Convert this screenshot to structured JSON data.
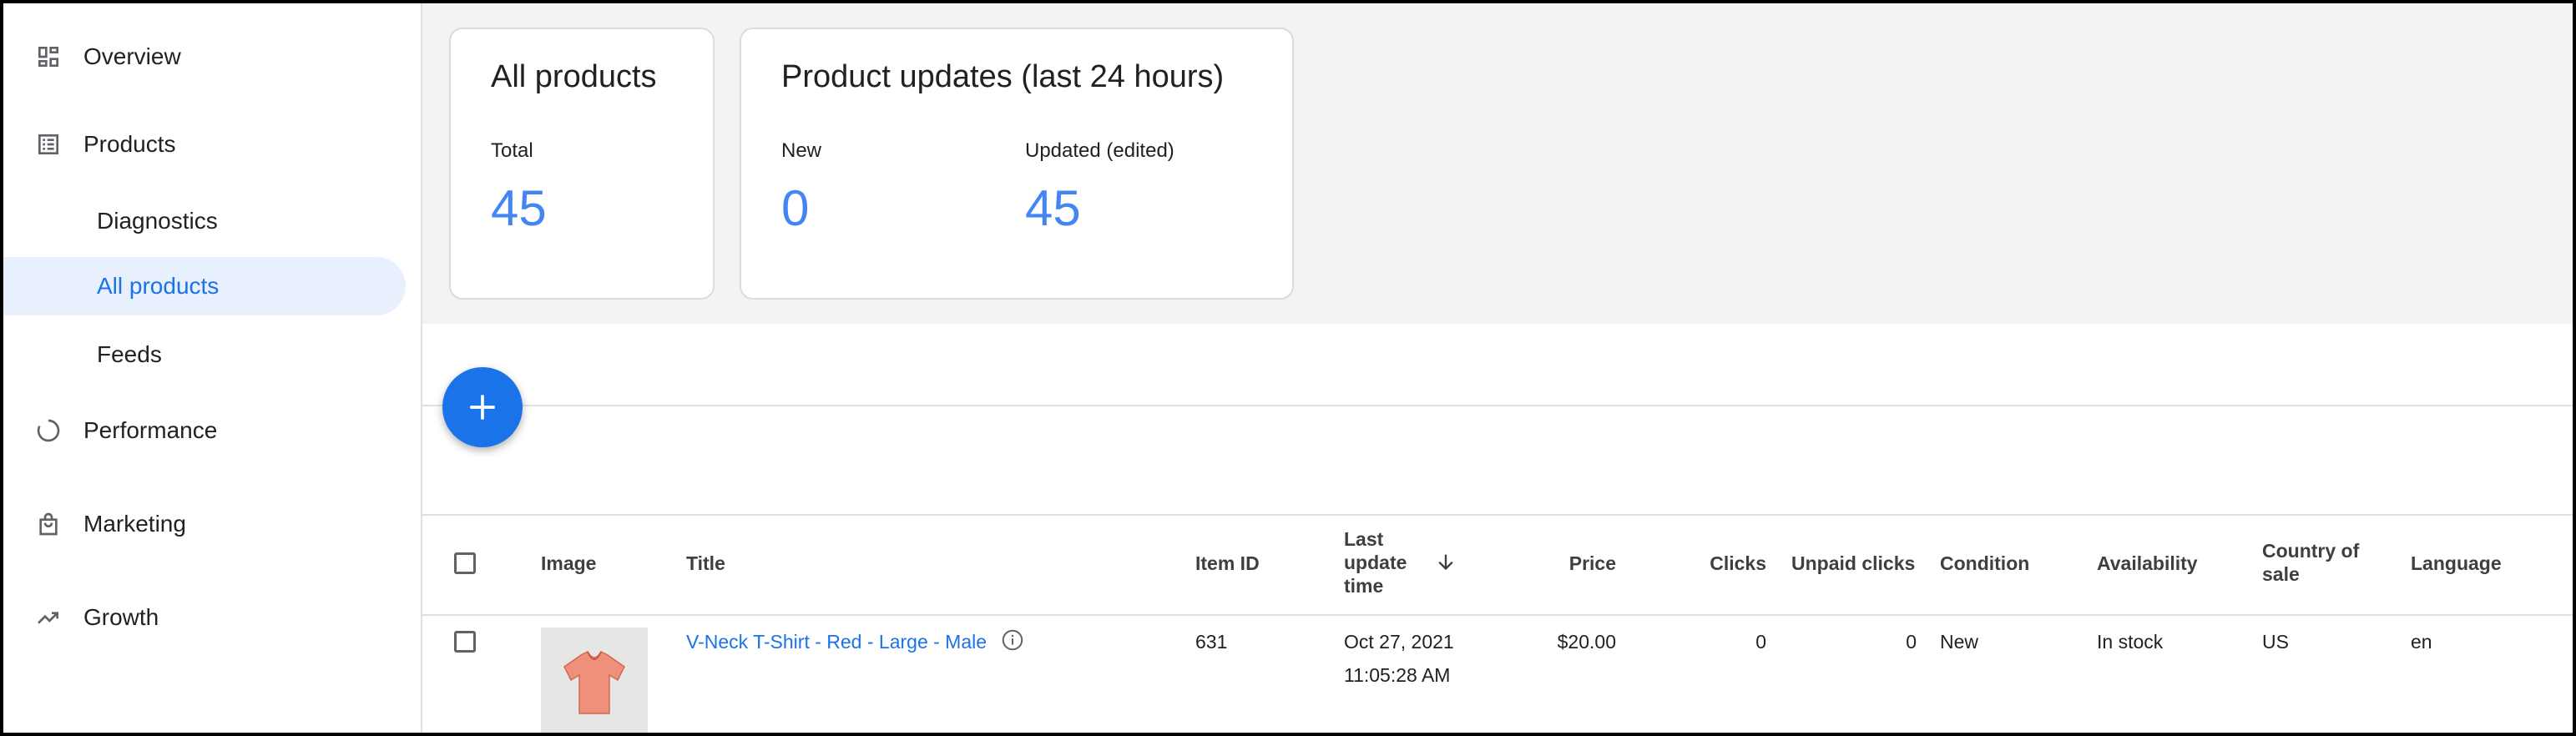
{
  "sidebar": {
    "items": [
      {
        "label": "Overview",
        "icon": "dashboard-icon"
      },
      {
        "label": "Products",
        "icon": "list-icon"
      },
      {
        "label": "Diagnostics"
      },
      {
        "label": "All products"
      },
      {
        "label": "Feeds"
      },
      {
        "label": "Performance",
        "icon": "performance-icon"
      },
      {
        "label": "Marketing",
        "icon": "marketing-bag-icon"
      },
      {
        "label": "Growth",
        "icon": "trending-up-icon"
      }
    ]
  },
  "summary": {
    "all_products": {
      "title": "All products",
      "total_label": "Total",
      "total_value": "45"
    },
    "updates": {
      "title": "Product updates (last 24 hours)",
      "new_label": "New",
      "new_value": "0",
      "updated_label": "Updated (edited)",
      "updated_value": "45"
    }
  },
  "table": {
    "headers": {
      "image": "Image",
      "title": "Title",
      "item_id": "Item ID",
      "last_update_1": "Last",
      "last_update_2": "update",
      "last_update_3": "time",
      "price": "Price",
      "clicks": "Clicks",
      "unpaid_clicks": "Unpaid clicks",
      "condition": "Condition",
      "availability": "Availability",
      "country_1": "Country of",
      "country_2": "sale",
      "language": "Language"
    },
    "rows": [
      {
        "title": "V-Neck T-Shirt - Red - Large - Male",
        "item_id": "631",
        "date": "Oct 27, 2021",
        "time": "11:05:28 AM",
        "price": "$20.00",
        "clicks": "0",
        "unpaid_clicks": "0",
        "condition": "New",
        "availability": "In stock",
        "country": "US",
        "language": "en"
      }
    ]
  },
  "colors": {
    "accent": "#1a73e8",
    "stat": "#4285f4",
    "active_bg": "#e8f0fe"
  }
}
